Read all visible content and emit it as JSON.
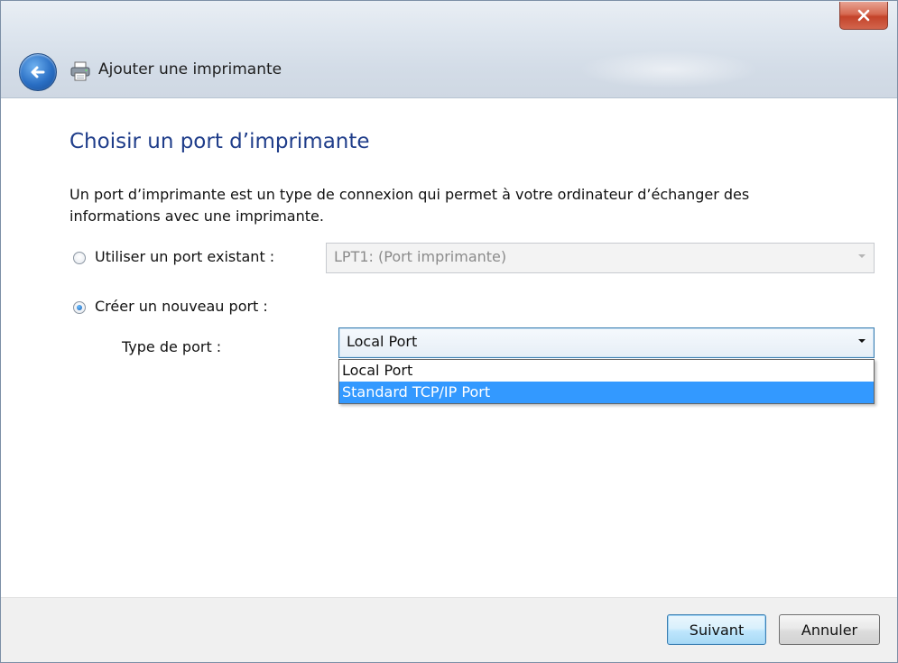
{
  "window": {
    "title": "Ajouter une imprimante"
  },
  "page": {
    "heading": "Choisir un port d’imprimante",
    "description": "Un port d’imprimante est un type de connexion qui permet à votre ordinateur d’échanger des informations avec une imprimante."
  },
  "existing_port": {
    "label": "Utiliser un port existant :",
    "selected": false,
    "combo_value": "LPT1: (Port imprimante)",
    "disabled": true
  },
  "new_port": {
    "label": "Créer un nouveau port :",
    "selected": true,
    "type_label": "Type de port :",
    "combo_value": "Local Port",
    "options": [
      "Local Port",
      "Standard TCP/IP Port"
    ],
    "highlighted_option": "Standard TCP/IP Port"
  },
  "buttons": {
    "next": "Suivant",
    "cancel": "Annuler"
  },
  "colors": {
    "heading": "#1f3d8a",
    "selection": "#3399ff",
    "close_button": "#c4432a"
  },
  "icons": {
    "back": "back-arrow-icon",
    "app": "printer-icon",
    "close": "close-icon",
    "dropdown": "chevron-down-icon"
  }
}
